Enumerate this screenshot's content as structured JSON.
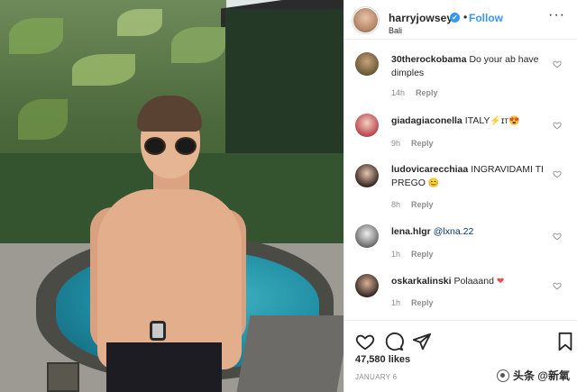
{
  "post": {
    "username": "harryjowsey",
    "verified_mark": "✓",
    "separator": "•",
    "follow_label": "Follow",
    "location": "Bali",
    "more_label": "···"
  },
  "comments": [
    {
      "username": "30therockobama",
      "text": "Do your ab have dimples",
      "time": "14h",
      "reply_label": "Reply"
    },
    {
      "username": "giadagiaconella",
      "text": "ITALY",
      "emoji": "⚡ɪᴛ😍",
      "time": "9h",
      "reply_label": "Reply"
    },
    {
      "username": "ludovicarecchiaa",
      "text": "INGRAVIDAMI TI PREGO",
      "emoji": "😊",
      "time": "8h",
      "reply_label": "Reply"
    },
    {
      "username": "lena.hlgr",
      "mention": "@lxna.22",
      "time": "1h",
      "reply_label": "Reply"
    },
    {
      "username": "oskarkalinski",
      "text": "Polaaand",
      "emoji": "❤",
      "time": "1h",
      "reply_label": "Reply"
    }
  ],
  "stats": {
    "likes": "47,580 likes",
    "date": "JANUARY 6"
  },
  "watermark": {
    "text": "头条 @新氧"
  },
  "icons": [
    "heart-icon",
    "comment-icon",
    "share-icon",
    "bookmark-icon",
    "verified-badge-icon",
    "more-icon"
  ],
  "colors": {
    "link_blue": "#3897f0",
    "text": "#262626",
    "muted": "#8e8e8e",
    "heart_red": "#ed4956"
  }
}
